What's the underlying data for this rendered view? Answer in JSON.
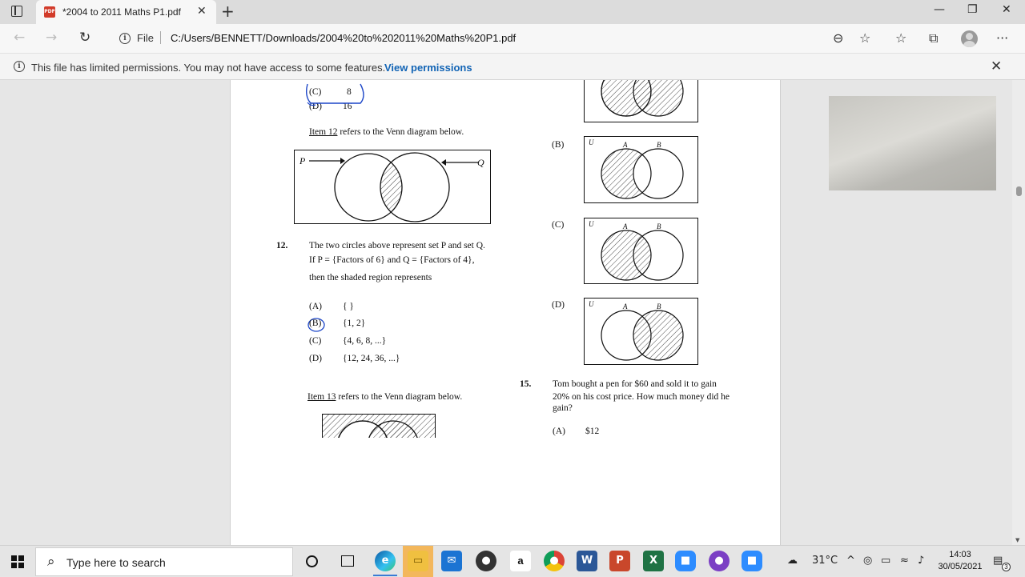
{
  "browser": {
    "tab_title": "*2004 to 2011 Maths P1.pdf",
    "pdf_badge": "PDF",
    "tab_close": "✕",
    "new_tab": "+",
    "win_min": "—",
    "win_restore": "❐",
    "win_close": "✕",
    "back": "←",
    "forward": "→",
    "refresh": "↻",
    "address_label": "File",
    "url": "C:/Users/BENNETT/Downloads/2004%20to%202011%20Maths%20P1.pdf",
    "zoom_icon": "⊖",
    "favorite_icon": "☆",
    "favorites_icon": "☆",
    "collections_icon": "⧉",
    "more_icon": "···",
    "info_message": "This file has limited permissions. You may not have access to some features.",
    "info_link": "View permissions",
    "info_close": "✕"
  },
  "doc": {
    "prev_option_C_letter": "(C)",
    "prev_option_C_value": "8",
    "prev_option_D_letter": "(D)",
    "prev_option_D_value": "16",
    "item12_ref_prefix": "Item 12",
    "item12_ref_suffix": " refers to the Venn diagram below.",
    "venn12_P": "P",
    "venn12_Q": "Q",
    "q12_number": "12.",
    "q12_line1": "The two circles above represent set P and set Q.",
    "q12_line2": "If P = {Factors of 6}  and  Q = {Factors of 4},",
    "q12_line3": "then the shaded region represents",
    "q12_options": [
      {
        "letter": "(A)",
        "value": "{ }"
      },
      {
        "letter": "(B)",
        "value": "{1, 2}"
      },
      {
        "letter": "(C)",
        "value": "{4, 6, 8, ...}"
      },
      {
        "letter": "(D)",
        "value": "{12, 24, 36, ...}"
      }
    ],
    "item13_ref_prefix": "Item 13",
    "item13_ref_suffix": " refers to the Venn diagram below.",
    "right_options": [
      {
        "letter": "(B)"
      },
      {
        "letter": "(C)"
      },
      {
        "letter": "(D)"
      }
    ],
    "venn_U": "U",
    "venn_A": "A",
    "venn_B": "B",
    "q15_number": "15.",
    "q15_line1": "Tom bought a pen for  $60  and sold it to gain",
    "q15_line2": "20%  on his cost price. How much money did he",
    "q15_line3": "gain?",
    "q15_optA_letter": "(A)",
    "q15_optA_value": "$12"
  },
  "taskbar": {
    "search_placeholder": "Type here to search",
    "weather_temp": "31°C",
    "time": "14:03",
    "date": "30/05/2021",
    "notification_count": "3",
    "apps": [
      "cortana",
      "task-view",
      "edge",
      "file-explorer",
      "mail",
      "media",
      "amazon",
      "chrome",
      "word",
      "powerpoint",
      "excel",
      "zoom",
      "app",
      "zoom-meetings"
    ]
  },
  "colors": {
    "accent": "#1264b5",
    "pen_annotation": "#1c46c8"
  }
}
